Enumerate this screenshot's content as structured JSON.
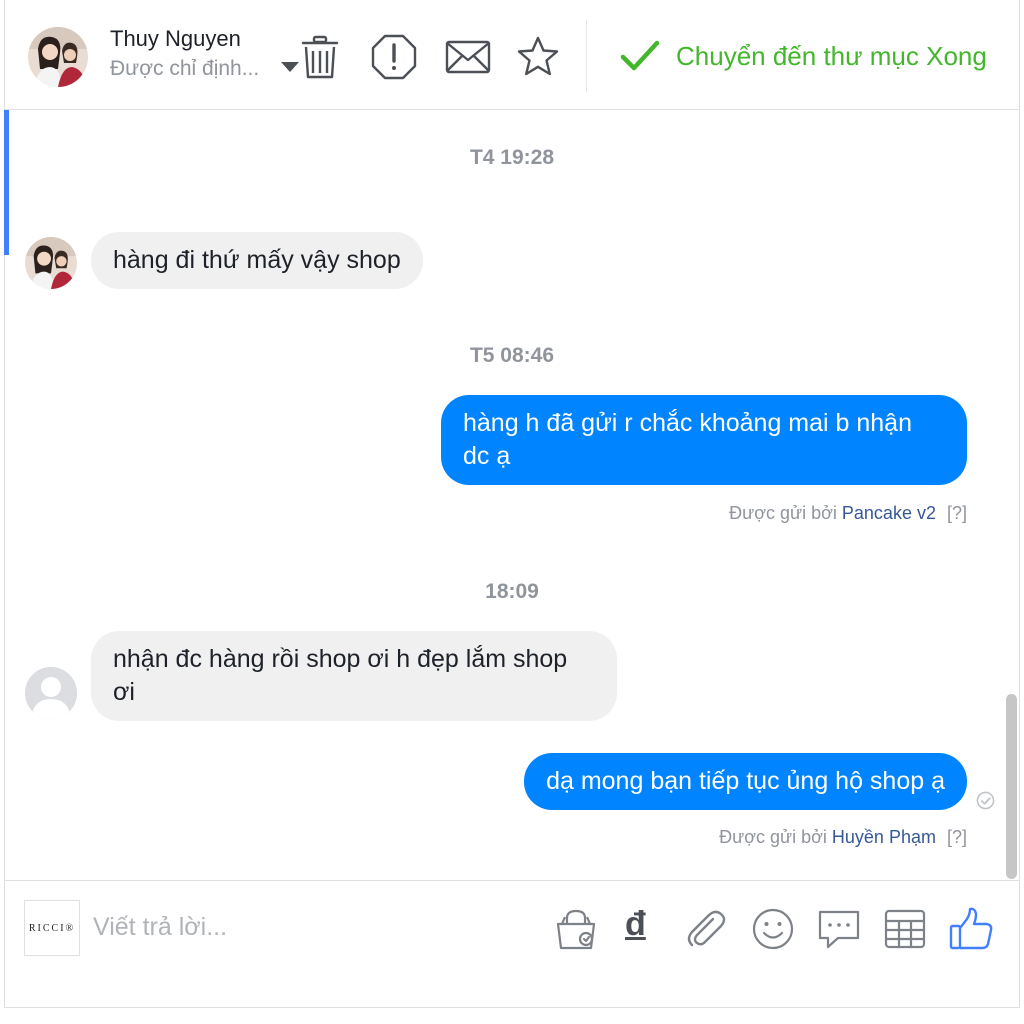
{
  "header": {
    "contact_name": "Thuy Nguyen",
    "assigned_label": "Được chỉ định...",
    "done_label": "Chuyển đến thư mục Xong",
    "accent_done": "#42b72a"
  },
  "icons": {
    "header": [
      "trash-icon",
      "report-icon",
      "mail-icon",
      "star-icon",
      "checkmark-icon"
    ],
    "composer": [
      "order-bag-icon",
      "currency-dong-icon",
      "attachment-icon",
      "emoji-icon",
      "quick-reply-icon",
      "table-icon",
      "like-icon"
    ]
  },
  "messages": [
    {
      "type": "timestamp",
      "text": "T4 19:28"
    },
    {
      "type": "incoming",
      "text": "hàng đi thứ mấy vậy shop"
    },
    {
      "type": "timestamp",
      "text": "T5 08:46"
    },
    {
      "type": "outgoing",
      "text": "hàng h đã gửi r chắc khoảng mai b nhận dc ạ",
      "sent_by_prefix": "Được gửi bởi",
      "sent_by": "Pancake v2",
      "help": "[?]"
    },
    {
      "type": "timestamp",
      "text": "18:09"
    },
    {
      "type": "incoming",
      "text": "nhận đc hàng rồi shop ơi h đẹp lắm shop ơi"
    },
    {
      "type": "outgoing",
      "text": "dạ mong bạn tiếp tục ủng hộ shop ạ",
      "sent_by_prefix": "Được gửi bởi",
      "sent_by": "Huyền Phạm",
      "help": "[?]"
    }
  ],
  "composer": {
    "page_logo_text": "RICCI®",
    "placeholder": "Viết trả lời...",
    "currency_symbol": "đ"
  },
  "colors": {
    "outgoing_bubble": "#0084ff",
    "incoming_bubble": "#f1f0f0",
    "link": "#365899",
    "icon": "#4b4f56",
    "like": "#4080ff"
  }
}
